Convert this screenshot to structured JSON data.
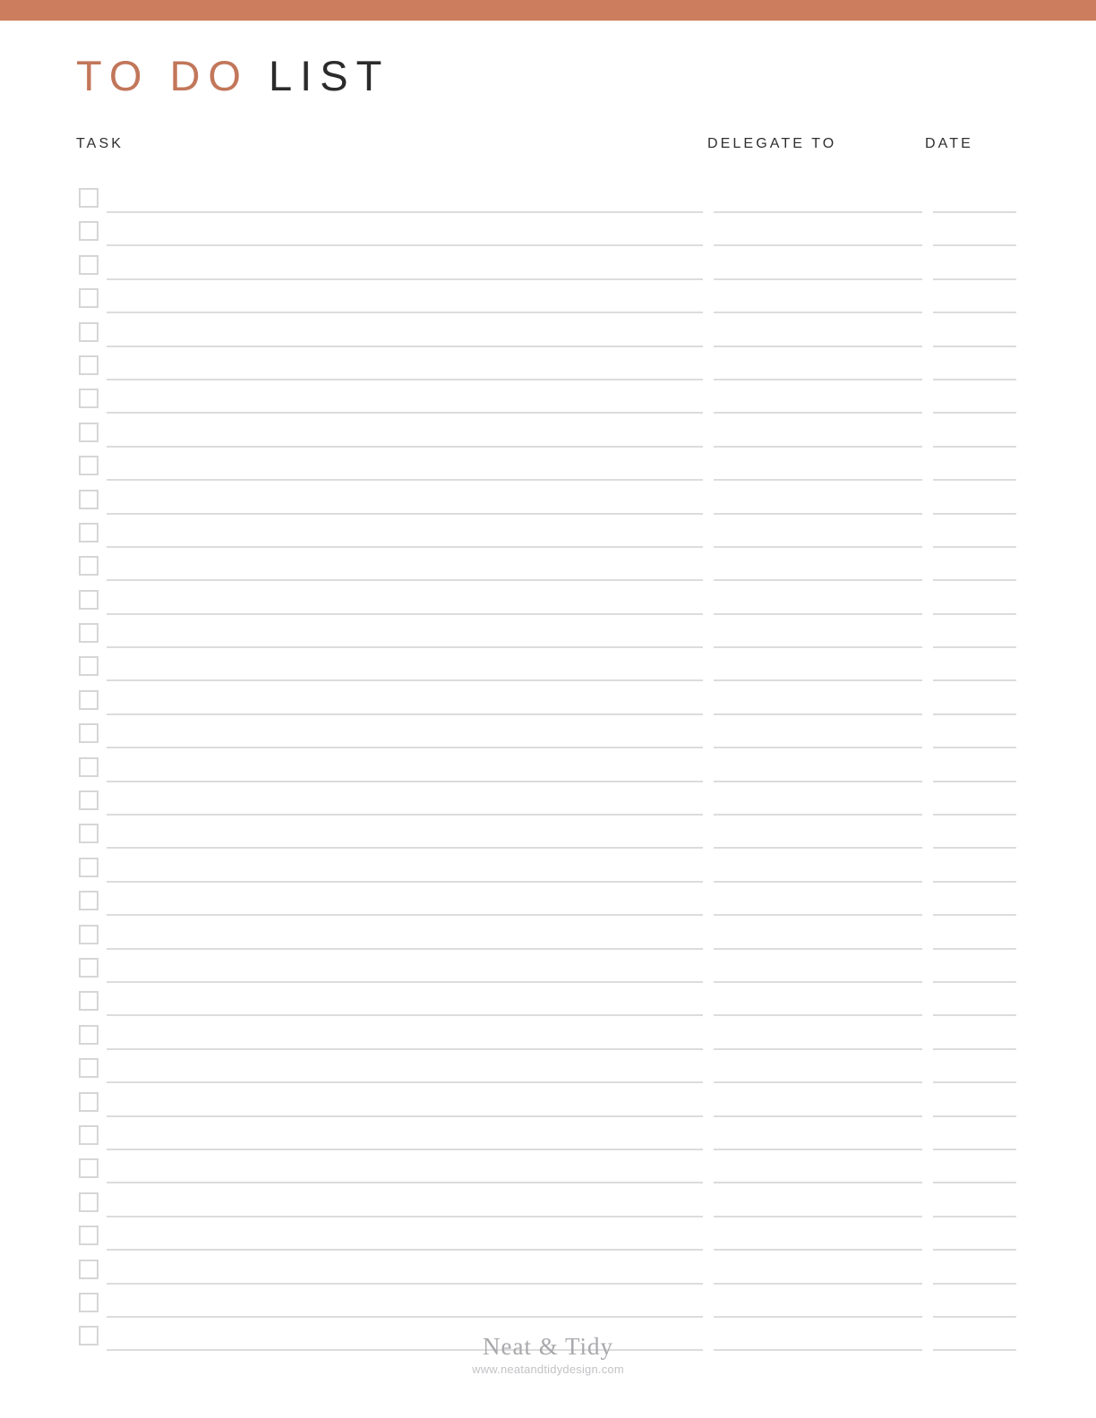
{
  "theme": {
    "accent_bar_color": "#CC7D5E",
    "title_accent_color": "#C2765A",
    "title_dark_color": "#2B2B2B",
    "rule_color": "#DCDCDC",
    "checkbox_border_color": "#D6D6D6",
    "footer_text_color": "#A9A9AD"
  },
  "title": {
    "accent_text": "TO DO ",
    "dark_text": "LIST"
  },
  "columns": {
    "task_label": "TASK",
    "delegate_label": "DELEGATE TO",
    "date_label": "DATE"
  },
  "rows": {
    "count": 35,
    "items": [
      {
        "checked": false,
        "task": "",
        "delegate": "",
        "date": ""
      },
      {
        "checked": false,
        "task": "",
        "delegate": "",
        "date": ""
      },
      {
        "checked": false,
        "task": "",
        "delegate": "",
        "date": ""
      },
      {
        "checked": false,
        "task": "",
        "delegate": "",
        "date": ""
      },
      {
        "checked": false,
        "task": "",
        "delegate": "",
        "date": ""
      },
      {
        "checked": false,
        "task": "",
        "delegate": "",
        "date": ""
      },
      {
        "checked": false,
        "task": "",
        "delegate": "",
        "date": ""
      },
      {
        "checked": false,
        "task": "",
        "delegate": "",
        "date": ""
      },
      {
        "checked": false,
        "task": "",
        "delegate": "",
        "date": ""
      },
      {
        "checked": false,
        "task": "",
        "delegate": "",
        "date": ""
      },
      {
        "checked": false,
        "task": "",
        "delegate": "",
        "date": ""
      },
      {
        "checked": false,
        "task": "",
        "delegate": "",
        "date": ""
      },
      {
        "checked": false,
        "task": "",
        "delegate": "",
        "date": ""
      },
      {
        "checked": false,
        "task": "",
        "delegate": "",
        "date": ""
      },
      {
        "checked": false,
        "task": "",
        "delegate": "",
        "date": ""
      },
      {
        "checked": false,
        "task": "",
        "delegate": "",
        "date": ""
      },
      {
        "checked": false,
        "task": "",
        "delegate": "",
        "date": ""
      },
      {
        "checked": false,
        "task": "",
        "delegate": "",
        "date": ""
      },
      {
        "checked": false,
        "task": "",
        "delegate": "",
        "date": ""
      },
      {
        "checked": false,
        "task": "",
        "delegate": "",
        "date": ""
      },
      {
        "checked": false,
        "task": "",
        "delegate": "",
        "date": ""
      },
      {
        "checked": false,
        "task": "",
        "delegate": "",
        "date": ""
      },
      {
        "checked": false,
        "task": "",
        "delegate": "",
        "date": ""
      },
      {
        "checked": false,
        "task": "",
        "delegate": "",
        "date": ""
      },
      {
        "checked": false,
        "task": "",
        "delegate": "",
        "date": ""
      },
      {
        "checked": false,
        "task": "",
        "delegate": "",
        "date": ""
      },
      {
        "checked": false,
        "task": "",
        "delegate": "",
        "date": ""
      },
      {
        "checked": false,
        "task": "",
        "delegate": "",
        "date": ""
      },
      {
        "checked": false,
        "task": "",
        "delegate": "",
        "date": ""
      },
      {
        "checked": false,
        "task": "",
        "delegate": "",
        "date": ""
      },
      {
        "checked": false,
        "task": "",
        "delegate": "",
        "date": ""
      },
      {
        "checked": false,
        "task": "",
        "delegate": "",
        "date": ""
      },
      {
        "checked": false,
        "task": "",
        "delegate": "",
        "date": ""
      },
      {
        "checked": false,
        "task": "",
        "delegate": "",
        "date": ""
      },
      {
        "checked": false,
        "task": "",
        "delegate": "",
        "date": ""
      }
    ]
  },
  "footer": {
    "brand": "Neat & Tidy",
    "url": "www.neatandtidydesign.com"
  }
}
